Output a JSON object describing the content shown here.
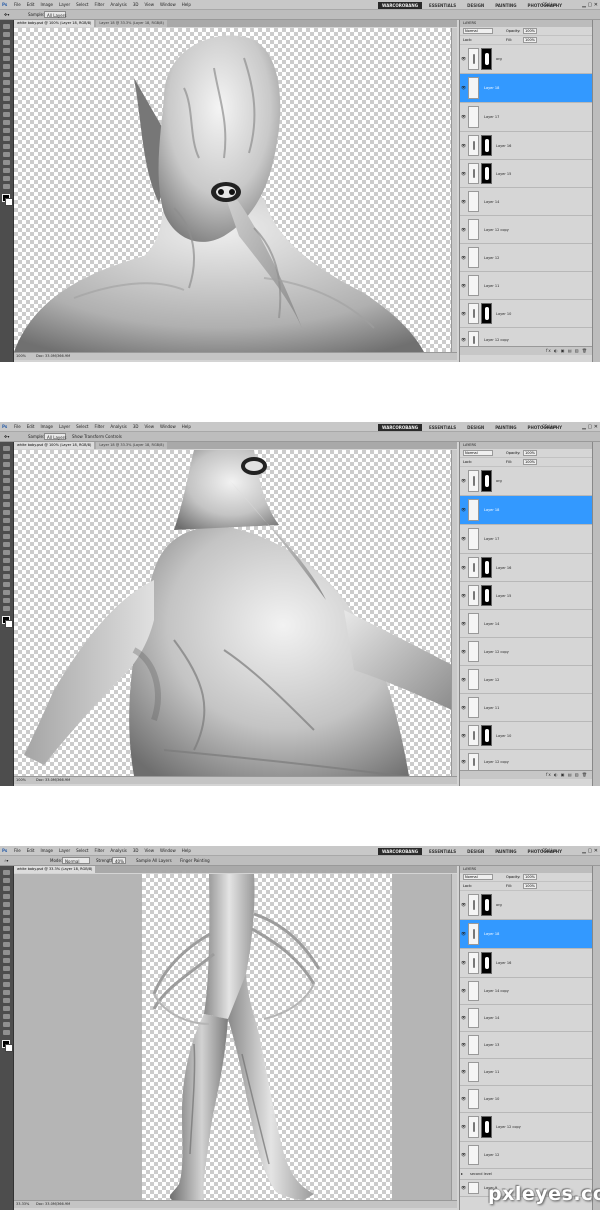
{
  "screens": [
    {
      "menu": [
        "File",
        "Edit",
        "Image",
        "Layer",
        "Select",
        "Filter",
        "Analysis",
        "3D",
        "View",
        "Window",
        "Help"
      ],
      "tool_options": {
        "sample_label": "Sample:",
        "sample_value": "All Layers",
        "extra": ""
      },
      "doc_tabs": [
        "white baby.psd @ 100% (Layer 18, RGB/8)",
        "Layer 18 @ 33.3% (Layer 18, RGB/8)"
      ],
      "zoom": "100%",
      "doc_size": "Doc: 33.0M/366.9M"
    },
    {
      "menu": [
        "File",
        "Edit",
        "Image",
        "Layer",
        "Select",
        "Filter",
        "Analysis",
        "3D",
        "View",
        "Window",
        "Help"
      ],
      "tool_options": {
        "sample_label": "Sample:",
        "sample_value": "All Layers",
        "extra": "Show Transform Controls"
      },
      "doc_tabs": [
        "white baby.psd @ 100% (Layer 18, RGB/8)",
        "Layer 18 @ 33.3% (Layer 18, RGB/8)"
      ],
      "zoom": "100%",
      "doc_size": "Doc: 33.0M/366.9M"
    },
    {
      "menu": [
        "File",
        "Edit",
        "Image",
        "Layer",
        "Select",
        "Filter",
        "Analysis",
        "3D",
        "View",
        "Window",
        "Help"
      ],
      "tool_options": {
        "mode_label": "Mode:",
        "mode_value": "Normal",
        "strength_label": "Strength:",
        "strength_value": "40%",
        "sample_all": "Sample All Layers",
        "finger": "Finger Painting"
      },
      "doc_tabs": [
        "white baby.psd @ 33.3% (Layer 18, RGB/8)"
      ],
      "zoom": "33.33%",
      "doc_size": "Doc: 33.0M/366.9M"
    }
  ],
  "workspaces": [
    "WARCOROBANG",
    "ESSENTIALS",
    "DESIGN",
    "PAINTING",
    "PHOTOGRAPHY"
  ],
  "cs_live": "CS Live",
  "layers_panel": {
    "tab": "LAYERS",
    "blend_mode": "Normal",
    "opacity_label": "Opacity:",
    "opacity_value": "100%",
    "fill_label": "Fill:",
    "fill_value": "100%",
    "lock_label": "Lock:"
  },
  "layer_lists": [
    [
      "org",
      "Layer 18",
      "Layer 17",
      "Layer 16",
      "Layer 15",
      "Layer 14",
      "Layer 12 copy",
      "Layer 12",
      "Layer 11",
      "Layer 10",
      "Layer 12 copy"
    ],
    [
      "org",
      "Layer 18",
      "Layer 17",
      "Layer 16",
      "Layer 15",
      "Layer 14",
      "Layer 12 copy",
      "Layer 12",
      "Layer 11",
      "Layer 10",
      "Layer 12 copy"
    ],
    [
      "org",
      "Layer 18",
      "Layer 16",
      "Layer 14 copy",
      "Layer 14",
      "Layer 13",
      "Layer 11",
      "Layer 10",
      "Layer 12 copy",
      "Layer 12",
      "second level",
      "Layer 9"
    ]
  ],
  "panel_footer": "fx ◐ ▣ ▤ ▥ 🗑",
  "watermark": "pxleyes.com",
  "colors": {
    "selection": "#3399ff",
    "chrome": "#d4d4d4",
    "toolbox": "#4d4d4d",
    "active_workspace": "#2a2a2a"
  }
}
